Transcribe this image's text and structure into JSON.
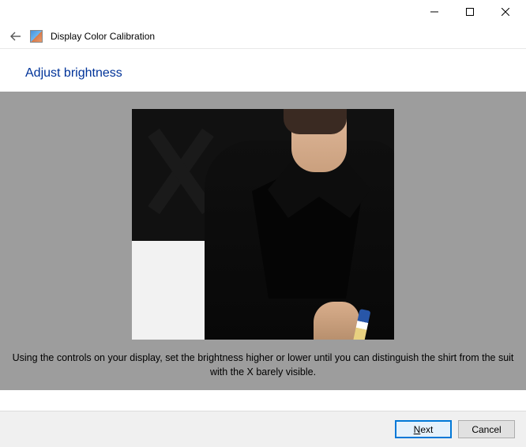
{
  "titlebar": {
    "minimize_icon": "minimize",
    "maximize_icon": "maximize",
    "close_icon": "close"
  },
  "header": {
    "back_icon": "back-arrow",
    "app_icon": "display-color-calibration-icon",
    "window_title": "Display Color Calibration"
  },
  "page": {
    "heading": "Adjust brightness",
    "instruction": "Using the controls on your display, set the brightness higher or lower until you can distinguish the shirt from the suit with the X barely visible."
  },
  "footer": {
    "next_label": "Next",
    "next_mnemonic": "N",
    "cancel_label": "Cancel"
  }
}
